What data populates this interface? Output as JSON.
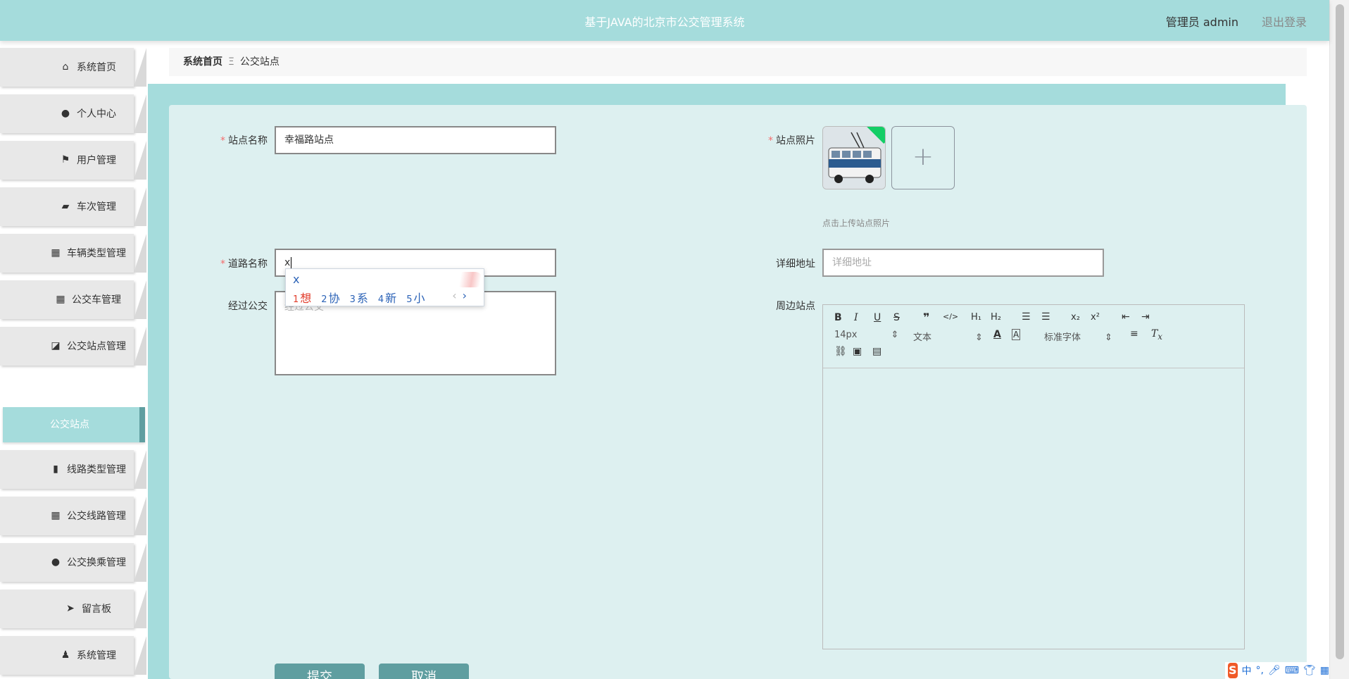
{
  "header": {
    "title": "基于JAVA的北京市公交管理系统",
    "user": "管理员 admin",
    "logout": "退出登录"
  },
  "sidebar": {
    "items": [
      {
        "label": "系统首页",
        "icon": "home-icon",
        "glyph": "⌂"
      },
      {
        "label": "个人中心",
        "icon": "user-icon",
        "glyph": "●"
      },
      {
        "label": "用户管理",
        "icon": "flag-icon",
        "glyph": "⚑"
      },
      {
        "label": "车次管理",
        "icon": "briefcase-icon",
        "glyph": "▰"
      },
      {
        "label": "车辆类型管理",
        "icon": "grid-icon",
        "glyph": "▦"
      },
      {
        "label": "公交车管理",
        "icon": "grid-icon",
        "glyph": "▦"
      },
      {
        "label": "公交站点管理",
        "icon": "chart-icon",
        "glyph": "◪"
      },
      {
        "label": "线路类型管理",
        "icon": "paint-brush-icon",
        "glyph": "▮"
      },
      {
        "label": "公交线路管理",
        "icon": "grid-icon",
        "glyph": "▦"
      },
      {
        "label": "公交换乘管理",
        "icon": "pin-icon",
        "glyph": "●"
      },
      {
        "label": "留言板",
        "icon": "paper-plane-icon",
        "glyph": "➤"
      },
      {
        "label": "系统管理",
        "icon": "admin-icon",
        "glyph": "♟"
      }
    ],
    "active_sub": "公交站点"
  },
  "breadcrumb": {
    "home": "系统首页",
    "separator": "Ξ",
    "current": "公交站点"
  },
  "form": {
    "station_name_label": "站点名称",
    "station_name_value": "幸福路站点",
    "photo_label": "站点照片",
    "photo_tip": "点击上传站点照片",
    "road_name_label": "道路名称",
    "road_name_value": "x",
    "address_label": "详细地址",
    "address_placeholder": "详细地址",
    "routes_label": "经过公交",
    "routes_placeholder": "经过公交",
    "nearby_label": "周边站点"
  },
  "ime": {
    "pinyin": "x",
    "candidates": [
      {
        "num": "1",
        "text": "想"
      },
      {
        "num": "2",
        "text": "协"
      },
      {
        "num": "3",
        "text": "系"
      },
      {
        "num": "4",
        "text": "新"
      },
      {
        "num": "5",
        "text": "小"
      }
    ],
    "prev": "‹",
    "next": "›"
  },
  "editor": {
    "font_size": "14px",
    "paragraph": "文本",
    "font_family": "标准字体"
  },
  "buttons": {
    "submit": "提交",
    "cancel": "取消"
  },
  "tray": {
    "logo": "S",
    "mode": "中",
    "punct": "°,"
  },
  "colors": {
    "accent": "#a5dcdc",
    "button": "#5f9ea0",
    "panel": "#ddf0f0",
    "required": "#f56c6c"
  }
}
